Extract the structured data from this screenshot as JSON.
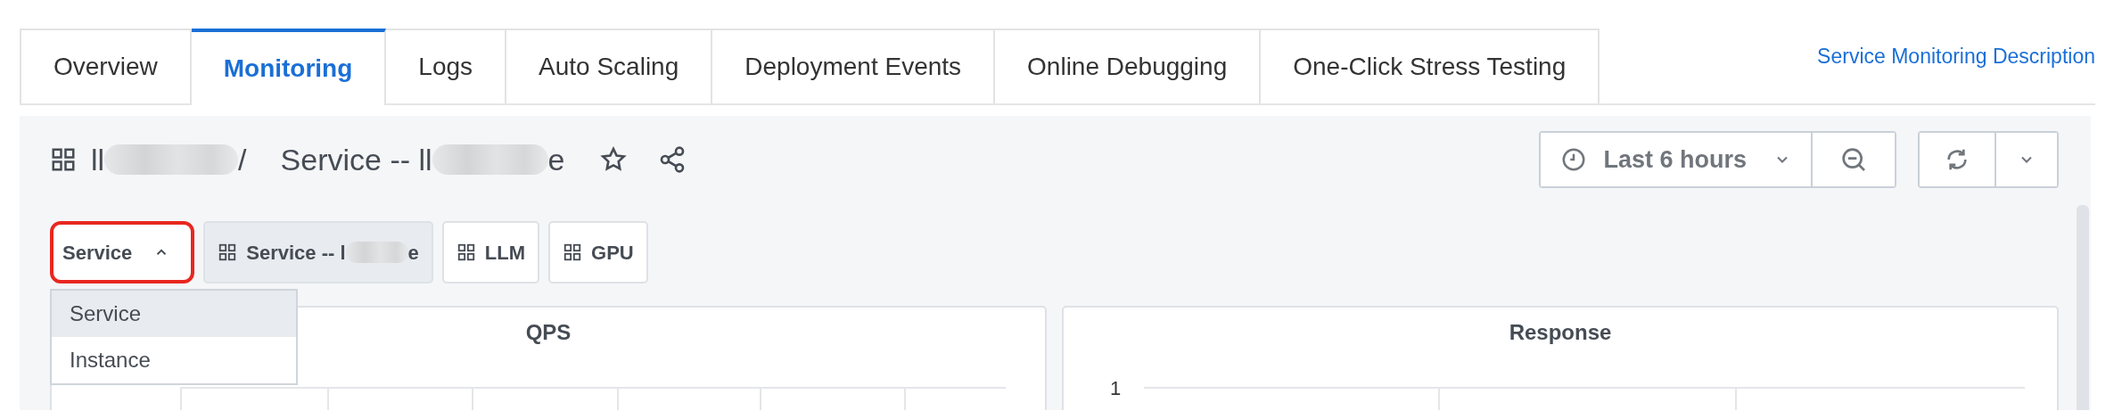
{
  "tabs": [
    {
      "label": "Overview",
      "selected": false
    },
    {
      "label": "Monitoring",
      "selected": true
    },
    {
      "label": "Logs",
      "selected": false
    },
    {
      "label": "Auto Scaling",
      "selected": false
    },
    {
      "label": "Deployment Events",
      "selected": false
    },
    {
      "label": "Online Debugging",
      "selected": false
    },
    {
      "label": "One-Click Stress Testing",
      "selected": false
    }
  ],
  "help_link": "Service Monitoring Description",
  "dashboard_title": {
    "name_start": "ll",
    "separator": "/",
    "sub_start": "Service -- ll",
    "sub_end": "e"
  },
  "time_range": {
    "label": "Last 6 hours"
  },
  "dashboard_selector": {
    "label": "Service",
    "expanded": true,
    "highlighted": true
  },
  "dashboard_buttons": [
    {
      "label": "Service -- l",
      "label_end": "e",
      "selected": true
    },
    {
      "label": "LLM",
      "selected": false
    },
    {
      "label": "GPU",
      "selected": false
    }
  ],
  "menu": {
    "items": [
      {
        "label": "Service",
        "selected": true
      },
      {
        "label": "Instance",
        "selected": false
      }
    ]
  },
  "panels": [
    {
      "title": "QPS"
    },
    {
      "title": "Response",
      "y_tick": "1"
    }
  ]
}
